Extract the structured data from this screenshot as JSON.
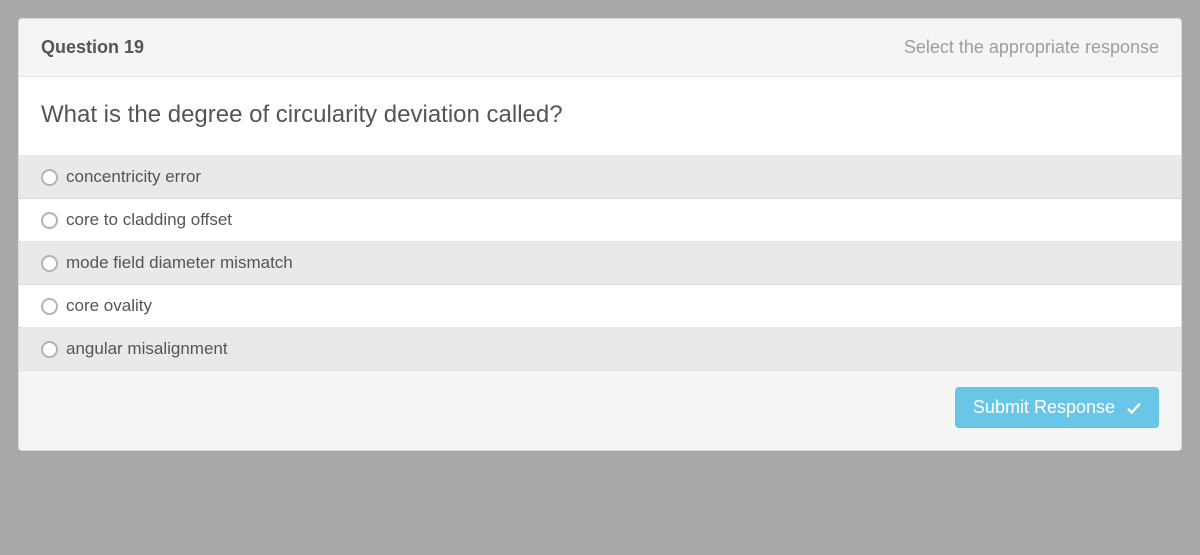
{
  "header": {
    "question_label": "Question 19",
    "instruction": "Select the appropriate response"
  },
  "question": {
    "text": "What is the degree of circularity deviation called?"
  },
  "options": [
    {
      "label": "concentricity error"
    },
    {
      "label": "core to cladding offset"
    },
    {
      "label": "mode field diameter mismatch"
    },
    {
      "label": "core ovality"
    },
    {
      "label": "angular misalignment"
    }
  ],
  "footer": {
    "submit_label": "Submit Response"
  }
}
